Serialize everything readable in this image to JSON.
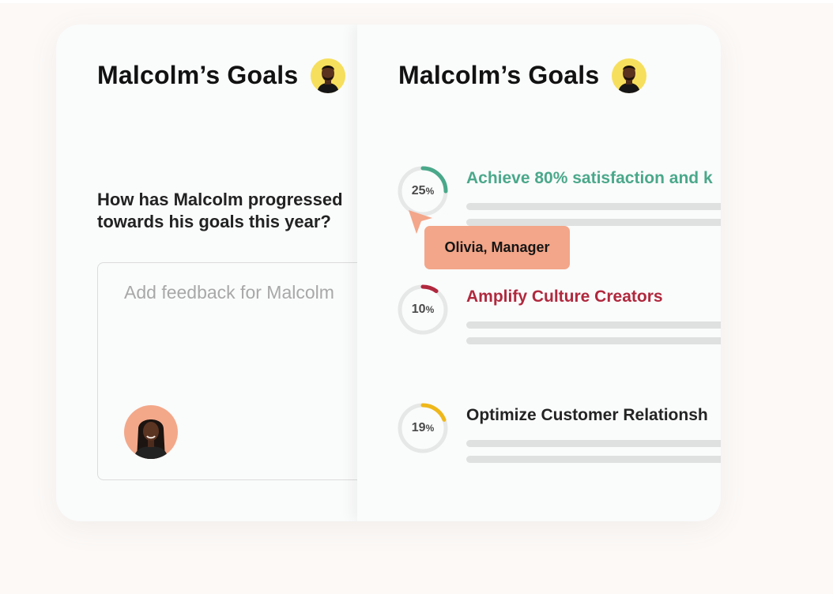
{
  "left_panel": {
    "title": "Malcolm’s Goals",
    "question_line1": "How has Malcolm progressed",
    "question_line2": "towards his goals this year?",
    "feedback_placeholder": "Add feedback for Malcolm"
  },
  "right_panel": {
    "title": "Malcolm’s Goals",
    "goals": [
      {
        "percent": "25",
        "percent_sign": "%",
        "progress": 0.25,
        "title": "Achieve 80% satisfaction and k",
        "color": "#4aa88a"
      },
      {
        "percent": "10",
        "percent_sign": "%",
        "progress": 0.1,
        "title": "Amplify Culture Creators",
        "color": "#b0283d"
      },
      {
        "percent": "19",
        "percent_sign": "%",
        "progress": 0.19,
        "title": "Optimize Customer Relationsh",
        "color": "#242424",
        "ring_color": "#efb81a"
      }
    ],
    "tooltip": "Olivia, Manager"
  },
  "colors": {
    "background": "#fcf9f7",
    "card": "#fafbfb",
    "avatar_yellow": "#f6df5c",
    "avatar_peach": "#f3a88a",
    "tooltip": "#f3a689",
    "ring_track": "#e6e7e7"
  }
}
